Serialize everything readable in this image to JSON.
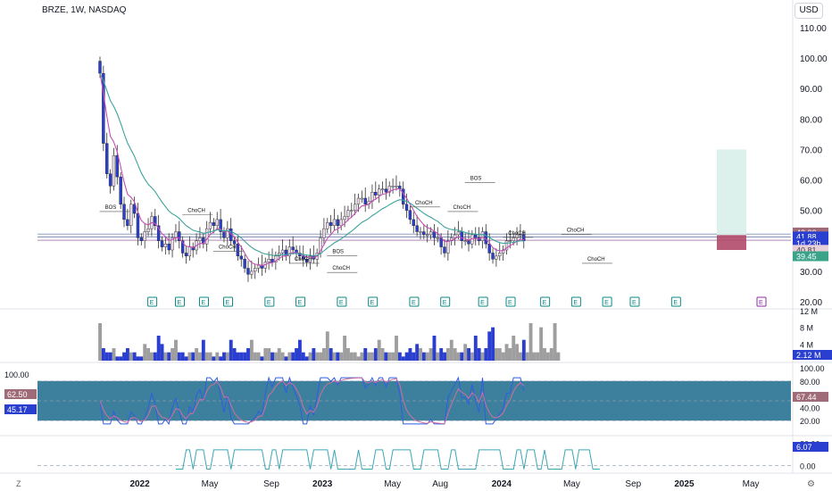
{
  "header": {
    "symbol_line": "BRZE, 1W, NASDAQ",
    "currency_button": "USD"
  },
  "corner_labels": {
    "left": "Z",
    "right": "⚙"
  },
  "colors": {
    "up": "#e8d8e8",
    "down": "#2a3fd0",
    "ema_fast": "#c44fb5",
    "ema_slow": "#3aa39a",
    "volume_up": "#9e9e9e",
    "volume_down": "#2a3fd0",
    "stoch_k": "#2f5de0",
    "stoch_d": "#d06ea0",
    "stoch_band": "#1b6a8c",
    "lower_line": "#3aa7b5",
    "earn_marker": "#0e8a85",
    "future_earn": "#8e2ba4",
    "long_box": "#0a6b5a",
    "short_box": "#a3284c"
  },
  "chart_data": [
    {
      "type": "candlestick",
      "title": "BRZE, 1W, NASDAQ",
      "ylim": [
        20,
        110
      ],
      "y_ticks": [
        "110.00",
        "100.00",
        "90.00",
        "80.00",
        "70.00",
        "60.00",
        "50.00",
        "40.00",
        "30.00",
        "20.00"
      ],
      "y_tick_values": [
        110,
        100,
        90,
        80,
        70,
        60,
        50,
        40,
        30,
        20
      ],
      "x_ticks": [
        "2022",
        "May",
        "Sep",
        "2023",
        "May",
        "Aug",
        "2024",
        "May",
        "Sep",
        "2025",
        "May"
      ],
      "x_tick_weeks": [
        4,
        24,
        42,
        57,
        77,
        91,
        109,
        129,
        147,
        162,
        181
      ],
      "ohlc_weeks_start": 0,
      "close": [
        95,
        72,
        62,
        58,
        68,
        61,
        52,
        47,
        45,
        52,
        49,
        41,
        40,
        43,
        44,
        48,
        45,
        40,
        38,
        39,
        37,
        41,
        43,
        40,
        36,
        35,
        38,
        37,
        40,
        41,
        39,
        44,
        46,
        45,
        47,
        43,
        41,
        44,
        40,
        39,
        35,
        34,
        31,
        29,
        30,
        31,
        32,
        31,
        33,
        34,
        33,
        35,
        36,
        37,
        35,
        38,
        37,
        36,
        35,
        34,
        33,
        35,
        34,
        36,
        41,
        44,
        46,
        45,
        47,
        45,
        47,
        48,
        50,
        50,
        52,
        54,
        54,
        52,
        53,
        56,
        55,
        57,
        57,
        56,
        58,
        58,
        58,
        57,
        52,
        50,
        47,
        45,
        43,
        43,
        42,
        42,
        43,
        41,
        41,
        38,
        36,
        40,
        41,
        42,
        43,
        40,
        40,
        39,
        42,
        41,
        40,
        43,
        39,
        36,
        34,
        35,
        36,
        37,
        40,
        40,
        41,
        42,
        42,
        40
      ],
      "ema_fast_label": "EMA",
      "ema_slow_label": "EMA",
      "current_price_label": "41.88",
      "countdown_label": "1d 23h",
      "level_label_high": "42.00",
      "level_label_low": "39.45",
      "level_label_mid": "40.81",
      "annotations": [
        {
          "text": "BOS",
          "week": 3,
          "price": 50.5
        },
        {
          "text": "ChoCH",
          "week": 27,
          "price": 49.5
        },
        {
          "text": "ChoCH",
          "week": 36,
          "price": 37.5
        },
        {
          "text": "ChoCH",
          "week": 58,
          "price": 33.5
        },
        {
          "text": "BOS",
          "week": 69,
          "price": 36.0
        },
        {
          "text": "ChoCH",
          "week": 69,
          "price": 30.5
        },
        {
          "text": "ChoCH",
          "week": 93,
          "price": 52.0
        },
        {
          "text": "BOS",
          "week": 109,
          "price": 60.0
        },
        {
          "text": "ChoCH",
          "week": 104,
          "price": 50.5
        },
        {
          "text": "ChoCH",
          "week": 120,
          "price": 42.0
        },
        {
          "text": "ChoCH",
          "week": 137,
          "price": 43.0
        },
        {
          "text": "ChoCH",
          "week": 143,
          "price": 33.5
        }
      ],
      "earnings_weeks": [
        10,
        18,
        25,
        32,
        44,
        53,
        65,
        74,
        86,
        95,
        106,
        114,
        124,
        133,
        142,
        150,
        162
      ],
      "earnings_label": "E"
    },
    {
      "type": "area",
      "title": "Volume",
      "y_ticks": [
        "12 M",
        "8 M",
        "4 M"
      ],
      "y_tick_values": [
        12,
        8,
        4
      ],
      "current_label": "2.12 M",
      "values": [
        9,
        3,
        2,
        2,
        3,
        1,
        1,
        2,
        3,
        2,
        2,
        1,
        1,
        4,
        3,
        2,
        2,
        6,
        4,
        2,
        2,
        3,
        5,
        2,
        2,
        1,
        2,
        2,
        3,
        2,
        5,
        2,
        2,
        1,
        2,
        1,
        2,
        2,
        5,
        3,
        2,
        2,
        2,
        3,
        5,
        2,
        2,
        1,
        3,
        3,
        2,
        2,
        3,
        2,
        1,
        2,
        2,
        3,
        5,
        2,
        1,
        2,
        3,
        2,
        2,
        3,
        7,
        3,
        2,
        2,
        2,
        6,
        3,
        2,
        2,
        1,
        2,
        3,
        2,
        2,
        3,
        5,
        3,
        2,
        2,
        2,
        6,
        2,
        1,
        2,
        3,
        2,
        4,
        3,
        2,
        2,
        3,
        6,
        2,
        3,
        2,
        3,
        5,
        3,
        2,
        2,
        4,
        3,
        2,
        6,
        3,
        2,
        3,
        7,
        8,
        3,
        3,
        2,
        4,
        3,
        6,
        4,
        2,
        5,
        2,
        9,
        2,
        2,
        8,
        3,
        2,
        3,
        9,
        2
      ]
    },
    {
      "type": "line",
      "title": "Stochastic",
      "ylim": [
        0,
        100
      ],
      "y_ticks": [
        "100.00",
        "80.00",
        "60.00",
        "40.00",
        "20.00"
      ],
      "y_tick_values": [
        100,
        80,
        60,
        40,
        20
      ],
      "k_label": "45.17",
      "d_label": "67.44",
      "left_label_top": "62.50",
      "band": [
        20,
        80
      ]
    },
    {
      "type": "line",
      "title": "Oscillator",
      "y_ticks": [
        "20.00",
        "0.00"
      ],
      "y_tick_values": [
        20,
        0
      ],
      "current_label": "6.07"
    }
  ]
}
